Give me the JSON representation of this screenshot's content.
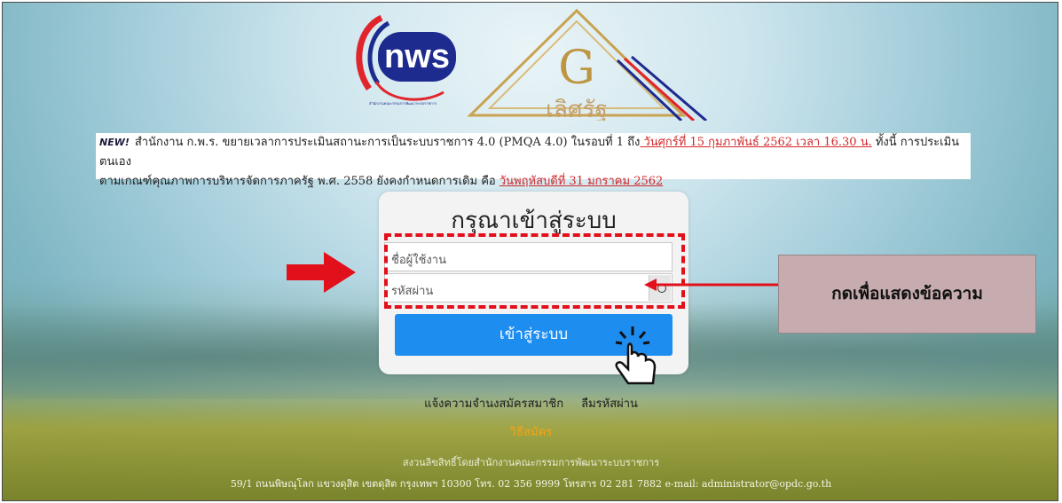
{
  "logo": {
    "nws_text": "nws",
    "seal_text": "สำนักงานคณะกรรมการพัฒนาระบบราชการ",
    "g_letter": "G",
    "g_subtext": "เลิศรัฐ"
  },
  "notice": {
    "badge": "NEW!",
    "line1_text": "สำนักงาน ก.พ.ร. ขยายเวลาการประเมินสถานะการเป็นระบบราชการ 4.0 (PMQA 4.0) ในรอบที่ 1 ถึง",
    "line1_date": " วันศุกร์ที่ 15 กุมภาพันธ์ 2562 เวลา 16.30 น.",
    "line1_tail": " ทั้งนี้ การประเมินตนเอง",
    "line2_text": "ตามเกณฑ์คุณภาพการบริหารจัดการภาครัฐ พ.ศ. 2558 ยังคงกำหนดการเดิม คือ ",
    "line2_date": "วันพฤหัสบดีที่ 31 มกราคม 2562"
  },
  "login": {
    "title": "กรุณาเข้าสู่ระบบ",
    "username_placeholder": "ชื่อผู้ใช้งาน",
    "password_placeholder": "รหัสผ่าน",
    "submit_label": "เข้าสู่ระบบ"
  },
  "annotation": {
    "callout_text": "กดเพื่อแสดงข้อความ"
  },
  "links": {
    "notify_member": "แจ้งความจำนงสมัครสมาชิก",
    "forgot_password": "ลืมรหัสผ่าน",
    "how_to_signup": "วิธีสมัคร"
  },
  "footer": {
    "copyright": "สงวนลิขสิทธิ์โดยสำนักงานคณะกรรมการพัฒนาระบบราชการ",
    "address": "59/1 ถนนพิษณุโลก แขวงดุสิต เขตดุสิต กรุงเทพฯ 10300 โทร. 02 356 9999 โทรสาร 02 281 7882 e-mail: administrator@opdc.go.th"
  },
  "colors": {
    "accent": "#1e8df0",
    "annotation_red": "#e2101b",
    "callout_bg": "#c6acae",
    "signup_link": "#f3a514",
    "notice_date": "#d2282a"
  }
}
